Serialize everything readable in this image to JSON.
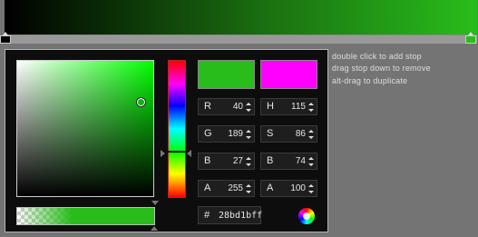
{
  "hints": {
    "line1": "double click to add stop",
    "line2": "drag stop down to remove",
    "line3": "alt-drag to duplicate"
  },
  "gradient": {
    "stops": [
      {
        "name": "stop-black",
        "color": "#000000",
        "position": 0.0
      },
      {
        "name": "stop-green",
        "color": "#28bd1b",
        "position": 1.0
      }
    ]
  },
  "picker": {
    "current_color": "#28bd1b",
    "previous_color": "#ff00ff",
    "rgb": {
      "r_label": "R",
      "r": "40",
      "g_label": "G",
      "g": "189",
      "b_label": "B",
      "b": "27"
    },
    "hsb": {
      "h_label": "H",
      "h": "115",
      "s_label": "S",
      "s": "86",
      "b_label": "B",
      "b": "74"
    },
    "alpha": {
      "a_label": "A",
      "rgb_alpha": "255",
      "hsb_alpha": "100"
    },
    "hex": {
      "hash": "#",
      "value": "28bd1bff"
    },
    "icons": {
      "wheel": "color-wheel-icon",
      "spinner": "spinner-arrows-icon"
    }
  }
}
